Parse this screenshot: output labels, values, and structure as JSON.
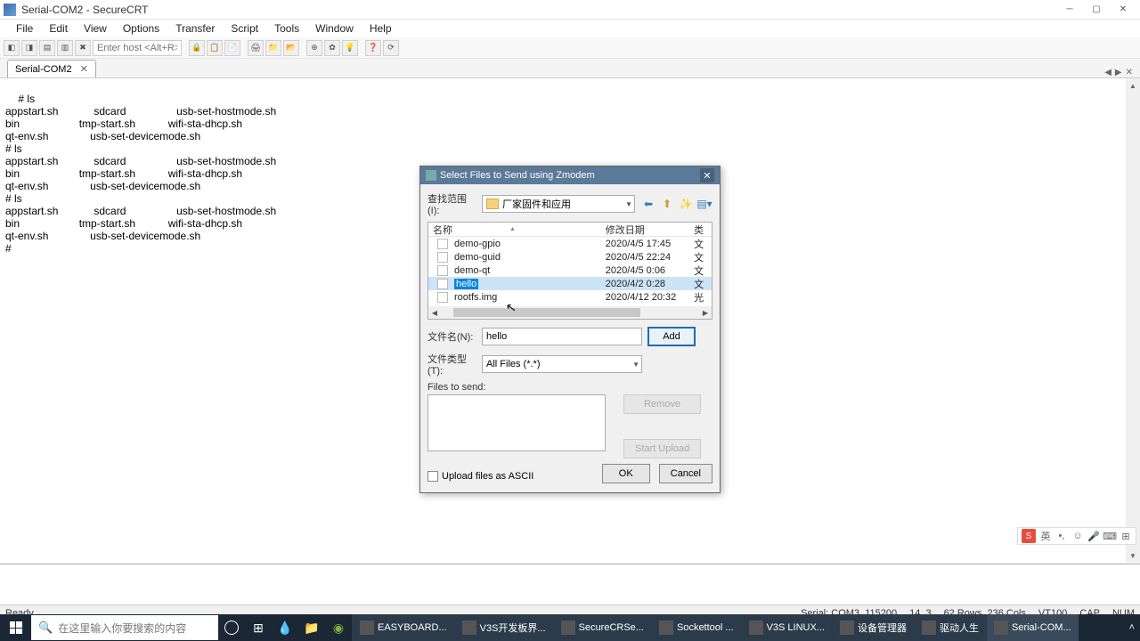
{
  "window": {
    "title": "Serial-COM2 - SecureCRT"
  },
  "menubar": [
    "File",
    "Edit",
    "View",
    "Options",
    "Transfer",
    "Script",
    "Tools",
    "Window",
    "Help"
  ],
  "toolbar_hint": "Enter host <Alt+R>",
  "tab": {
    "name": "Serial-COM2"
  },
  "terminal_lines": "# ls\nappstart.sh            sdcard                 usb-set-hostmode.sh\nbin                    tmp-start.sh           wifi-sta-dhcp.sh\nqt-env.sh              usb-set-devicemode.sh\n# ls\nappstart.sh            sdcard                 usb-set-hostmode.sh\nbin                    tmp-start.sh           wifi-sta-dhcp.sh\nqt-env.sh              usb-set-devicemode.sh\n# ls\nappstart.sh            sdcard                 usb-set-hostmode.sh\nbin                    tmp-start.sh           wifi-sta-dhcp.sh\nqt-env.sh              usb-set-devicemode.sh\n#",
  "dialog": {
    "title": "Select Files to Send using Zmodem",
    "lookin_label": "查找范围(I):",
    "lookin_value": "厂家固件和应用",
    "columns": {
      "name": "名称",
      "date": "修改日期",
      "type": "类"
    },
    "files": [
      {
        "name": "demo-gpio",
        "date": "2020/4/5 17:45",
        "type": "文"
      },
      {
        "name": "demo-guid",
        "date": "2020/4/5 22:24",
        "type": "文"
      },
      {
        "name": "demo-qt",
        "date": "2020/4/5 0:06",
        "type": "文"
      },
      {
        "name": "hello",
        "date": "2020/4/2 0:28",
        "type": "文",
        "selected": true
      },
      {
        "name": "rootfs.img",
        "date": "2020/4/12 20:32",
        "type": "光"
      }
    ],
    "filename_label": "文件名(N):",
    "filename_value": "hello",
    "filetype_label": "文件类型(T):",
    "filetype_value": "All Files (*.*)",
    "files_to_send_label": "Files to send:",
    "add_btn": "Add",
    "remove_btn": "Remove",
    "start_upload_btn": "Start Upload",
    "ascii_chk": "Upload files as ASCII",
    "ok_btn": "OK",
    "cancel_btn": "Cancel"
  },
  "status": {
    "left": "Ready",
    "serial": "Serial: COM3, 115200",
    "pos": "14,   3",
    "size": "62 Rows, 236 Cols",
    "term": "VT100",
    "caps": "CAP",
    "num": "NUM"
  },
  "taskbar": {
    "search_placeholder": "在这里输入你要搜索的内容",
    "apps": [
      {
        "label": "EASYBOARD..."
      },
      {
        "label": "V3S开发板界..."
      },
      {
        "label": "SecureCRSe..."
      },
      {
        "label": "Sockettool ..."
      },
      {
        "label": "V3S LINUX..."
      },
      {
        "label": "设备管理器"
      },
      {
        "label": "驱动人生"
      },
      {
        "label": "Serial-COM...",
        "active": true
      }
    ]
  }
}
